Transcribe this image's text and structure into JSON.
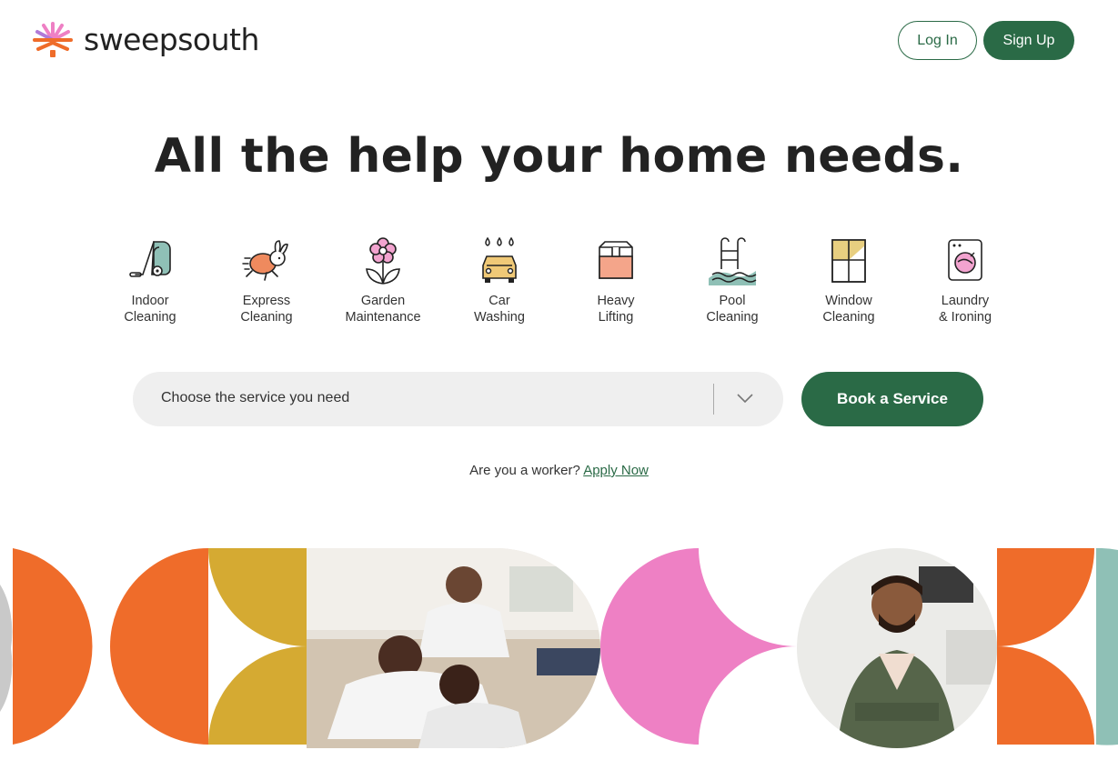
{
  "header": {
    "brand": "sweepsouth",
    "login_label": "Log In",
    "signup_label": "Sign Up"
  },
  "hero": {
    "title": "All the help your home needs."
  },
  "services": [
    {
      "label": "Indoor\nCleaning",
      "icon": "vacuum-icon"
    },
    {
      "label": "Express\nCleaning",
      "icon": "rabbit-icon"
    },
    {
      "label": "Garden\nMaintenance",
      "icon": "flower-icon"
    },
    {
      "label": "Car\nWashing",
      "icon": "car-icon"
    },
    {
      "label": "Heavy\nLifting",
      "icon": "box-icon"
    },
    {
      "label": "Pool\nCleaning",
      "icon": "pool-ladder-icon"
    },
    {
      "label": "Window\nCleaning",
      "icon": "window-icon"
    },
    {
      "label": "Laundry\n& Ironing",
      "icon": "washing-machine-icon"
    }
  ],
  "booking": {
    "select_placeholder": "Choose the service you need",
    "book_label": "Book a Service"
  },
  "worker": {
    "prompt": "Are you a worker?",
    "link": "Apply Now"
  },
  "colors": {
    "brand_green": "#2a6a46",
    "orange": "#ef6c2a",
    "mustard": "#d5aa32",
    "pink": "#ee80c4",
    "teal": "#8fc0b6"
  }
}
